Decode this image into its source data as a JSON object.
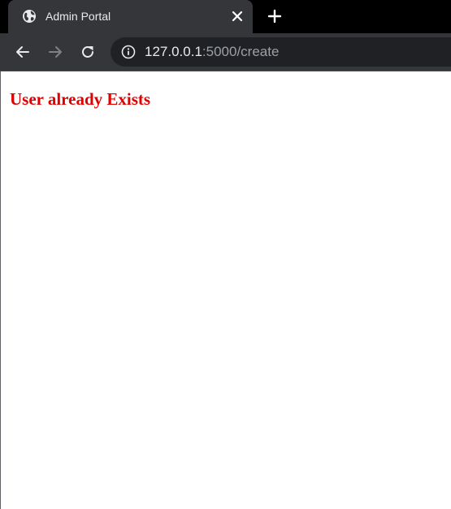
{
  "browser": {
    "tab": {
      "title": "Admin Portal",
      "favicon": "globe-icon",
      "close_icon": "close-icon"
    },
    "new_tab_icon": "plus-icon",
    "nav": {
      "back_icon": "arrow-left-icon",
      "forward_icon": "arrow-right-icon",
      "reload_icon": "reload-icon"
    },
    "address_bar": {
      "info_icon": "info-icon",
      "host": "127.0.0.1",
      "rest": ":5000/create"
    }
  },
  "page": {
    "message": "User already Exists"
  },
  "colors": {
    "tab_strip": "#000000",
    "toolbar": "#35363a",
    "omnibox": "#202124",
    "message": "#e00000"
  }
}
